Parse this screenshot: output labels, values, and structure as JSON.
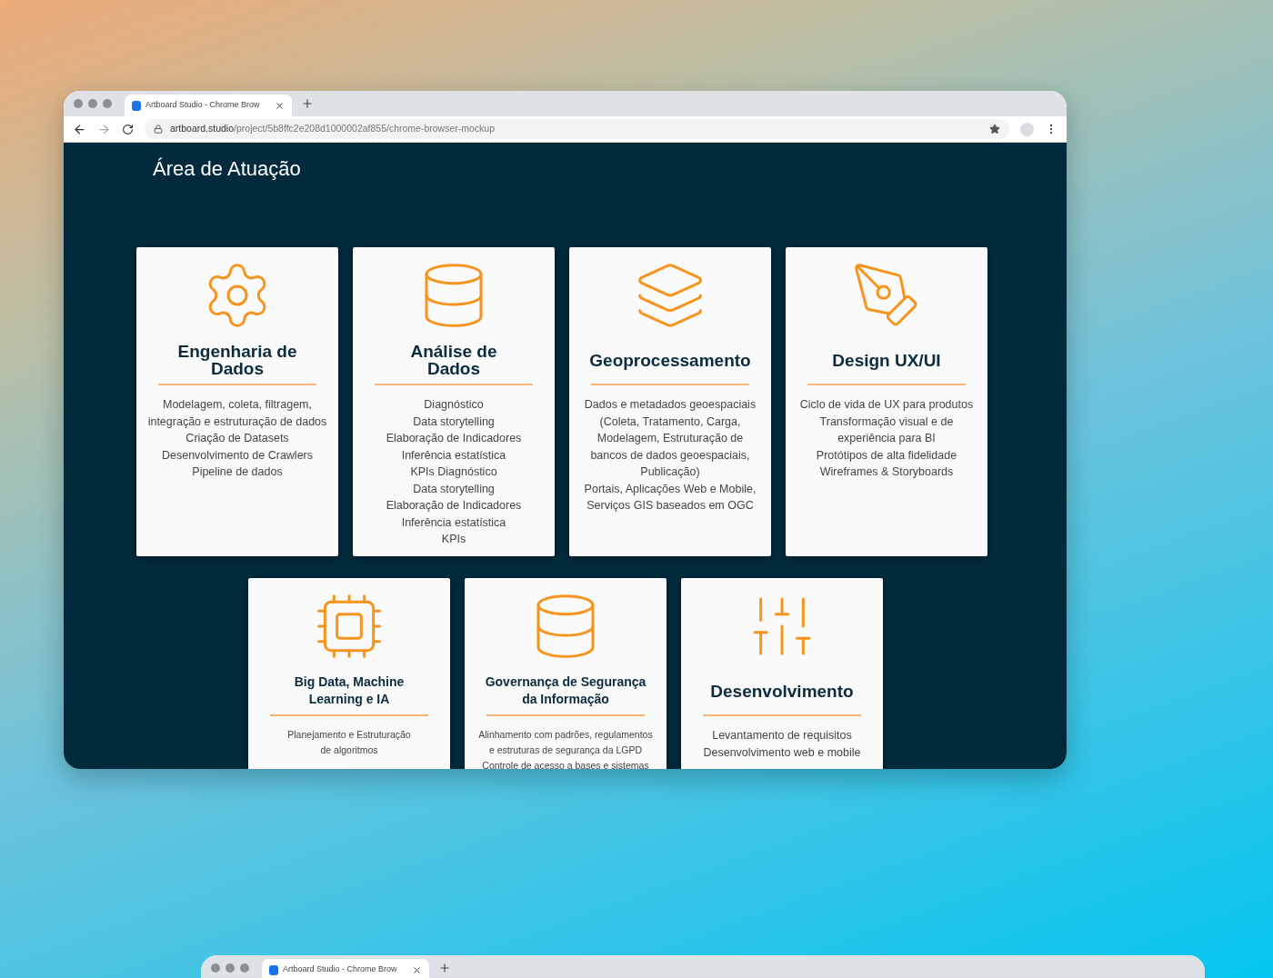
{
  "browser": {
    "tab": {
      "title": "Artboard Studio - Chrome Brow"
    },
    "url": {
      "host": "artboard.studio",
      "path": "/project/5b8ffc2e208d1000002af855/chrome-browser-mockup"
    }
  },
  "page": {
    "heading": "Área de Atuação",
    "cards": [
      {
        "title_lines": [
          "Engenharia de",
          "Dados"
        ],
        "items": [
          "Modelagem, coleta, filtragem,",
          "integração e estruturação de dados",
          "Criação de Datasets",
          "Desenvolvimento de Crawlers",
          "Pipeline de dados"
        ]
      },
      {
        "title_lines": [
          "Análise de",
          "Dados"
        ],
        "items": [
          "Diagnóstico",
          "Data storytelling",
          "Elaboração de Indicadores",
          "Inferência estatística",
          "KPIs Diagnóstico",
          "Data storytelling",
          "Elaboração de Indicadores",
          "Inferência estatística",
          "KPIs"
        ]
      },
      {
        "title_lines": [
          "Geoprocessamento"
        ],
        "items": [
          "Dados e metadados geoespaciais",
          "(Coleta, Tratamento, Carga,",
          "Modelagem, Estruturação de",
          "bancos de dados geoespaciais,",
          "Publicação)",
          "Portais, Aplicações Web e Mobile,",
          "Serviços GIS baseados em OGC"
        ]
      },
      {
        "title_lines": [
          "Design UX/UI"
        ],
        "items": [
          "Ciclo de vida de UX para produtos",
          "Transformação visual e de",
          "experiência para BI",
          "Protótipos de alta fidelidade",
          "Wireframes & Storyboards"
        ]
      },
      {
        "title_lines": [
          "Big Data, Machine",
          "Learning e IA"
        ],
        "items": [
          "Planejamento e Estruturação",
          "de algoritmos"
        ]
      },
      {
        "title_lines": [
          "Governança de Segurança",
          "da Informação"
        ],
        "items": [
          "Alinhamento com padrões, regulamentos",
          "e estruturas de segurança da LGPD",
          "Controle de acesso a bases e sistemas"
        ]
      },
      {
        "title_lines": [
          "Desenvolvimento"
        ],
        "items": [
          "Levantamento de requisitos",
          "Desenvolvimento web e mobile"
        ]
      }
    ]
  },
  "second_browser": {
    "tab": {
      "title": "Artboard Studio - Chrome Brow"
    }
  }
}
